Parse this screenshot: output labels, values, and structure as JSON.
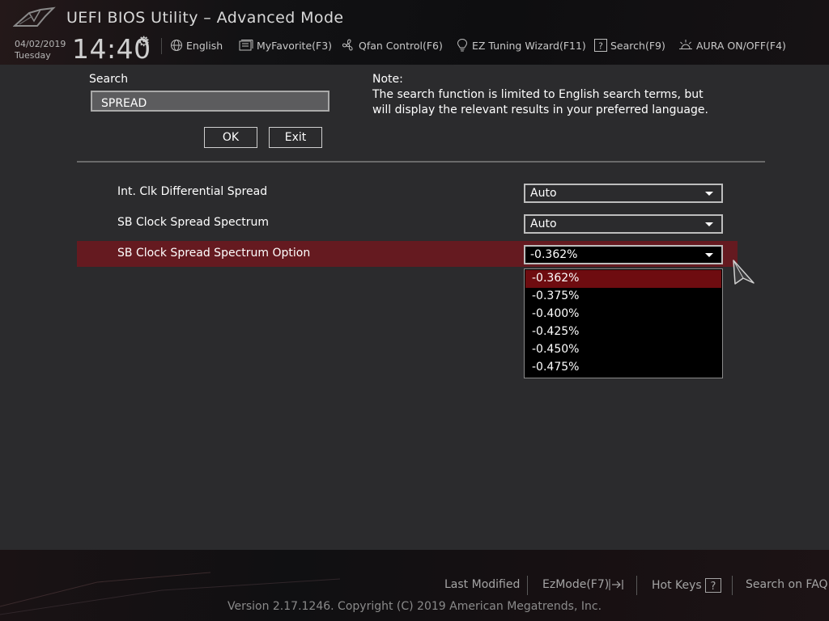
{
  "header": {
    "title": "UEFI BIOS Utility – Advanced Mode",
    "date": "04/02/2019",
    "day": "Tuesday",
    "time": "14:40",
    "items": [
      {
        "label": "English",
        "icon": "globe-icon"
      },
      {
        "label": "MyFavorite(F3)",
        "icon": "favorite-icon"
      },
      {
        "label": "Qfan Control(F6)",
        "icon": "fan-icon"
      },
      {
        "label": "EZ Tuning Wizard(F11)",
        "icon": "lightbulb-icon"
      },
      {
        "label": "Search(F9)",
        "icon": "search-icon"
      },
      {
        "label": "AURA ON/OFF(F4)",
        "icon": "aura-icon"
      }
    ]
  },
  "search": {
    "label": "Search",
    "value": "SPREAD",
    "ok_label": "OK",
    "exit_label": "Exit",
    "note_title": "Note:",
    "note_text": "The search function is limited to English search terms, but will display the relevant results in your preferred language."
  },
  "results": [
    {
      "label": "Int. Clk Differential Spread",
      "value": "Auto"
    },
    {
      "label": "SB Clock Spread Spectrum",
      "value": "Auto"
    },
    {
      "label": "SB Clock Spread Spectrum Option",
      "value": "-0.362%",
      "selected": true
    }
  ],
  "dropdown": {
    "options": [
      "-0.362%",
      "-0.375%",
      "-0.400%",
      "-0.425%",
      "-0.450%",
      "-0.475%"
    ],
    "selected_index": 0
  },
  "footer": {
    "last_modified": "Last Modified",
    "ezmode": "EzMode(F7)",
    "hot_keys": "Hot Keys",
    "search_faq": "Search on FAQ",
    "copyright": "Version 2.17.1246. Copyright (C) 2019 American Megatrends, Inc."
  },
  "colors": {
    "background": "#2b2b2d",
    "highlight_row": "#651a20",
    "dropdown_selected": "#6e0c10",
    "header_bg": "#121214"
  }
}
